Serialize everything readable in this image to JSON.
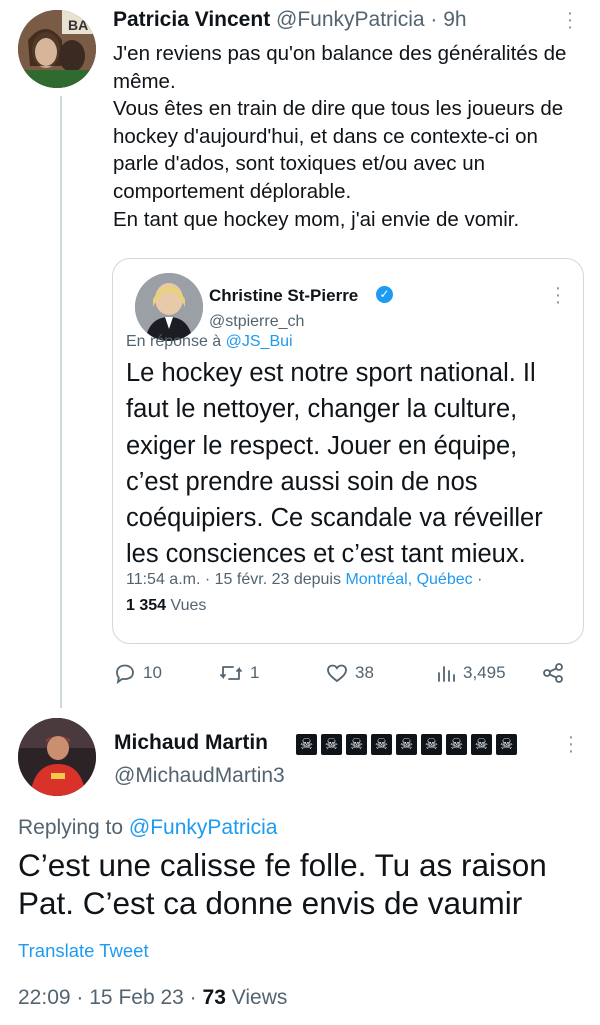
{
  "parent_tweet": {
    "author_name": "Patricia Vincent",
    "author_handle": "@FunkyPatricia",
    "time": "9h",
    "dot": "·",
    "text_lines": [
      "J'en reviens pas qu'on balance des généralités de même.",
      "Vous êtes en train de dire que tous les joueurs de hockey d'aujourd'hui, et dans ce contexte-ci on parle d'ados, sont toxiques et/ou avec un comportement déplorable.",
      "En tant que hockey mom, j'ai envie de vomir."
    ],
    "avatar_label": "BA",
    "quoted": {
      "author_name": "Christine St-Pierre",
      "author_handle": "@stpierre_ch",
      "reply_prefix": "En réponse à",
      "reply_to": "@JS_Bui",
      "text": "Le hockey est notre sport national. Il faut le nettoyer, changer la culture, exiger le respect. Jouer en équipe, c’est prendre aussi soin de nos coéquipiers. Ce scandale va réveiller les consciences  et c’est tant mieux.",
      "time": "11:54 a.m.",
      "date": "15 févr. 23",
      "via_prefix": "depuis",
      "location": "Montréal, Québec",
      "views_count": "1 354",
      "views_label": "Vues"
    },
    "actions": {
      "replies": "10",
      "retweets": "1",
      "likes": "38",
      "views": "3,495"
    }
  },
  "reply_tweet": {
    "author_name": "Michaud Martin",
    "name_emoji_count": 9,
    "skull_glyph": "☠",
    "author_handle": "@MichaudMartin3",
    "replying_prefix": "Replying to",
    "replying_to": "@FunkyPatricia",
    "text": "C’est une calisse fe folle. Tu as raison Pat.  C’est ca donne envis de vaumir",
    "translate_label": "Translate Tweet",
    "time": "22:09",
    "date": "15 Feb 23",
    "views_count": "73",
    "views_label": "Views"
  },
  "colors": {
    "link": "#1d9bf0",
    "muted": "#536471",
    "border": "#cfd9de",
    "text": "#0f1419"
  }
}
